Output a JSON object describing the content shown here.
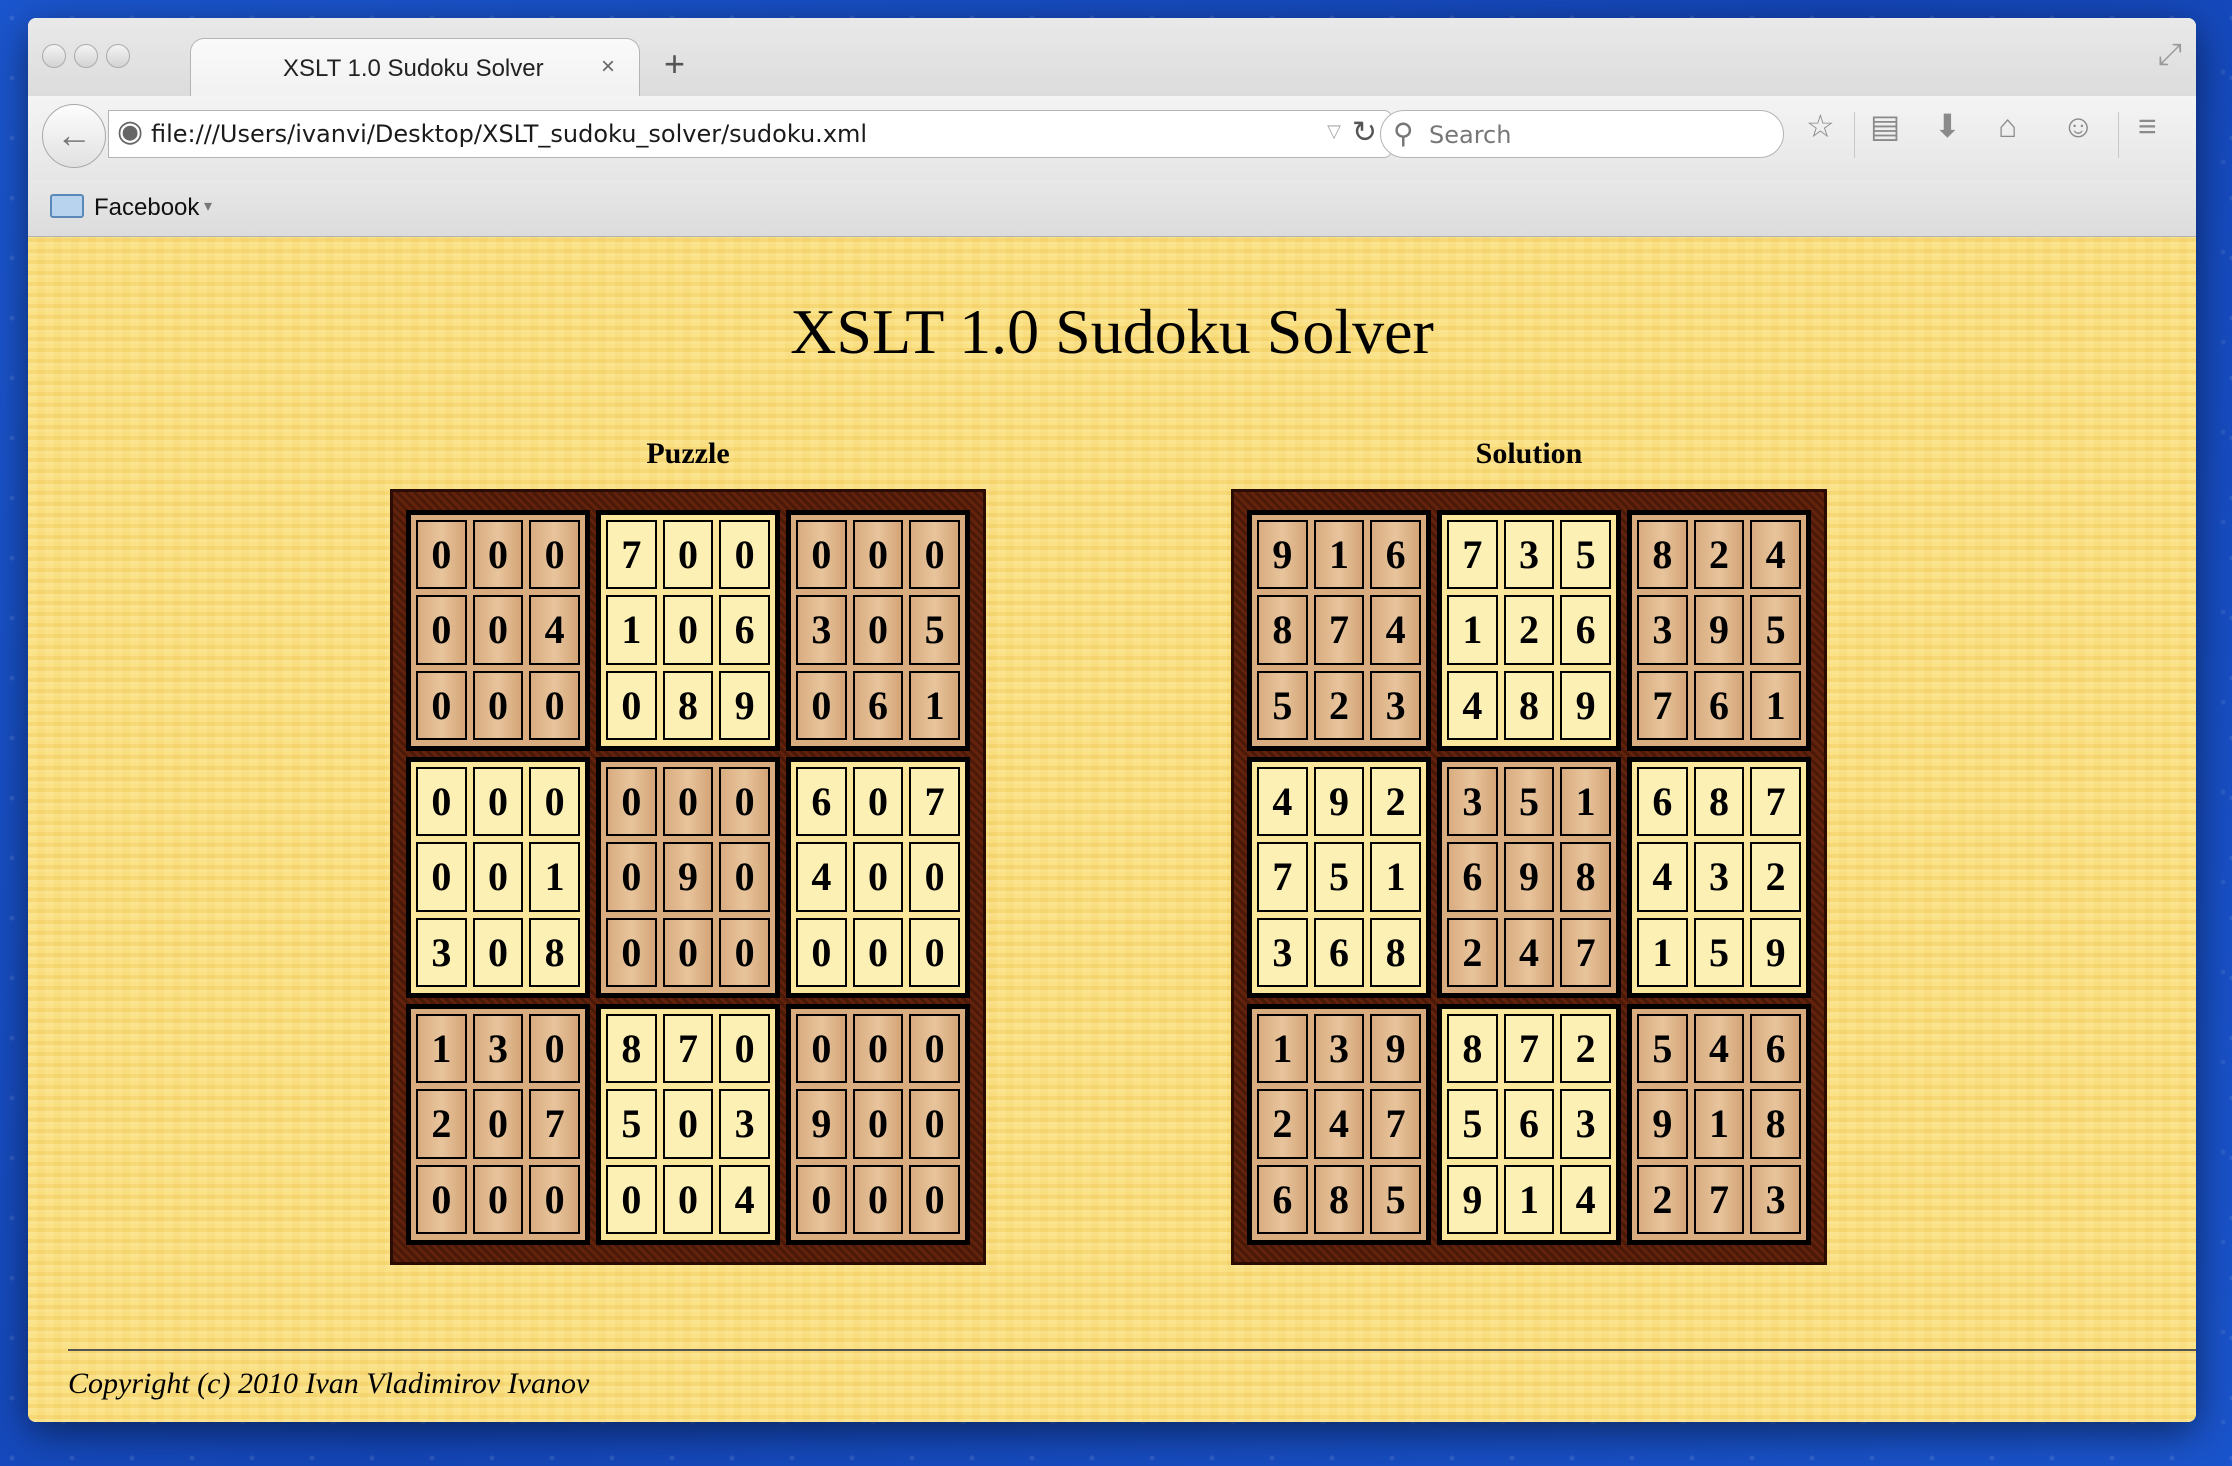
{
  "browser": {
    "tab_title": "XSLT 1.0 Sudoku Solver",
    "tab_close": "×",
    "new_tab": "+",
    "url": "file:///Users/ivanvi/Desktop/XSLT_sudoku_solver/sudoku.xml",
    "search_placeholder": "Search",
    "bookmark_folder": "Facebook"
  },
  "page": {
    "title": "XSLT 1.0 Sudoku Solver",
    "puzzle_label": "Puzzle",
    "solution_label": "Solution",
    "copyright": "Copyright (c) 2010 Ivan Vladimirov Ivanov"
  },
  "puzzle": [
    [
      [
        0,
        0,
        0,
        0,
        0,
        4,
        0,
        0,
        0
      ],
      [
        7,
        0,
        0,
        1,
        0,
        6,
        0,
        8,
        9
      ],
      [
        0,
        0,
        0,
        3,
        0,
        5,
        0,
        6,
        1
      ]
    ],
    [
      [
        0,
        0,
        0,
        0,
        0,
        1,
        3,
        0,
        8
      ],
      [
        0,
        0,
        0,
        0,
        9,
        0,
        0,
        0,
        0
      ],
      [
        6,
        0,
        7,
        4,
        0,
        0,
        0,
        0,
        0
      ]
    ],
    [
      [
        1,
        3,
        0,
        2,
        0,
        7,
        0,
        0,
        0
      ],
      [
        8,
        7,
        0,
        5,
        0,
        3,
        0,
        0,
        4
      ],
      [
        0,
        0,
        0,
        9,
        0,
        0,
        0,
        0,
        0
      ]
    ]
  ],
  "solution": [
    [
      [
        9,
        1,
        6,
        8,
        7,
        4,
        5,
        2,
        3
      ],
      [
        7,
        3,
        5,
        1,
        2,
        6,
        4,
        8,
        9
      ],
      [
        8,
        2,
        4,
        3,
        9,
        5,
        7,
        6,
        1
      ]
    ],
    [
      [
        4,
        9,
        2,
        7,
        5,
        1,
        3,
        6,
        8
      ],
      [
        3,
        5,
        1,
        6,
        9,
        8,
        2,
        4,
        7
      ],
      [
        6,
        8,
        7,
        4,
        3,
        2,
        1,
        5,
        9
      ]
    ],
    [
      [
        1,
        3,
        9,
        2,
        4,
        7,
        6,
        8,
        5
      ],
      [
        8,
        7,
        2,
        5,
        6,
        3,
        9,
        1,
        4
      ],
      [
        5,
        4,
        6,
        9,
        1,
        8,
        2,
        7,
        3
      ]
    ]
  ],
  "box_styles": [
    "wood",
    "cream",
    "wood",
    "cream",
    "wood",
    "cream",
    "wood",
    "cream",
    "wood"
  ]
}
